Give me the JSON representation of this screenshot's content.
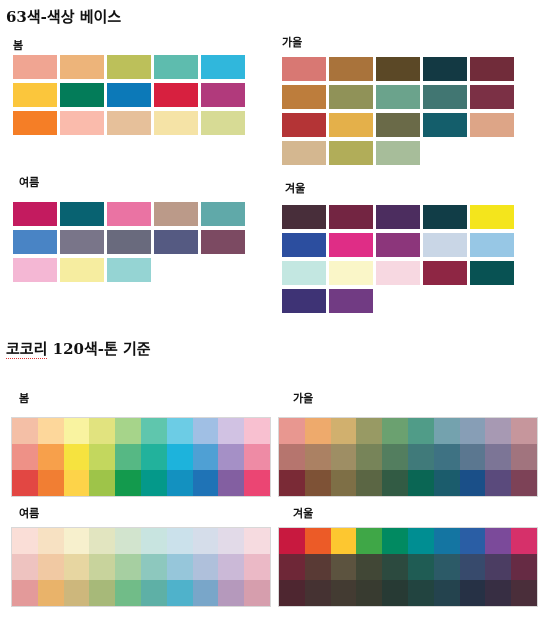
{
  "title_63": "63색-색상 베이스",
  "title_120": {
    "prefix": "코코리",
    "rest": " 120색-톤 기준"
  },
  "sec63": {
    "spring": {
      "label": "봄",
      "colors": [
        "#F0A592",
        "#EDB47A",
        "#BCC05A",
        "#5EBCAE",
        "#30B7DC",
        "#FBC63C",
        "#037C59",
        "#0C79B8",
        "#D7203F",
        "#B13A7C",
        "#F57E26",
        "#FABBAC",
        "#E6C09A",
        "#F5E3A6",
        "#D7DB95"
      ]
    },
    "autumn": {
      "label": "가을",
      "colors": [
        "#D87873",
        "#A9733B",
        "#5B4826",
        "#133943",
        "#712C3A",
        "#BD7D3C",
        "#909258",
        "#6BA38C",
        "#417672",
        "#7B3045",
        "#B43436",
        "#E4B04A",
        "#6A6A48",
        "#145E6B",
        "#DDA587",
        "#D4B790",
        "#B1AD59",
        "#A7BD9A"
      ]
    },
    "summer": {
      "label": "여름",
      "colors": [
        "#C31B5F",
        "#086271",
        "#EA73A3",
        "#BB9A89",
        "#60A9A9",
        "#4984C5",
        "#797589",
        "#696A7D",
        "#555A82",
        "#7C4A62",
        "#F4B7D4",
        "#F6EDA0",
        "#95D4D3"
      ]
    },
    "winter": {
      "label": "겨울",
      "colors": [
        "#482E3A",
        "#732542",
        "#4C2D5F",
        "#113D47",
        "#F4E51C",
        "#2C4E9F",
        "#DF2D86",
        "#8C367B",
        "#C9D6E6",
        "#97C7E5",
        "#C3E7E1",
        "#FAF6C8",
        "#F7D8E1",
        "#8E2644",
        "#085253",
        "#3E3375",
        "#713B83"
      ]
    }
  },
  "sec120": {
    "spring": {
      "label": "봄",
      "rows": [
        [
          "#F4BFA6",
          "#FDD79B",
          "#F9F3A0",
          "#E1E37F",
          "#A6D48A",
          "#5FC6AD",
          "#6CCCE5",
          "#A0BFE4",
          "#D1C2E3",
          "#F8C0D0"
        ],
        [
          "#EE9187",
          "#F7A04B",
          "#F6E33F",
          "#C3D75E",
          "#56B884",
          "#22B29C",
          "#1DB3DC",
          "#4FA0D4",
          "#A590C6",
          "#EE8BA5"
        ],
        [
          "#E24743",
          "#F17E33",
          "#FDD349",
          "#9EC449",
          "#139A4D",
          "#04998A",
          "#1391C0",
          "#1F73B6",
          "#835FA1",
          "#EB4573"
        ]
      ]
    },
    "autumn": {
      "label": "가을",
      "rows": [
        [
          "#E89790",
          "#EEAA6C",
          "#D1B06E",
          "#989A64",
          "#6BA170",
          "#509C88",
          "#74A2AE",
          "#879EB6",
          "#A799B3",
          "#C6969C"
        ],
        [
          "#B6756E",
          "#AB8163",
          "#9E8E64",
          "#778459",
          "#537E5F",
          "#407A7A",
          "#3E7283",
          "#5B7790",
          "#7C7596",
          "#A1747E"
        ],
        [
          "#7A2A36",
          "#7E5236",
          "#7E6F46",
          "#5B6644",
          "#325B44",
          "#0A6654",
          "#1B5C6C",
          "#1A4F88",
          "#5A4A7C",
          "#7D4257"
        ]
      ]
    },
    "summer": {
      "label": "여름",
      "rows": [
        [
          "#FADED7",
          "#F7E1C2",
          "#F7F0CD",
          "#E2E5C0",
          "#D2E4CE",
          "#C8E4E0",
          "#CBE1EB",
          "#D5DDEA",
          "#E2DAE8",
          "#F6DBE0"
        ],
        [
          "#EEC3C0",
          "#F1C9A3",
          "#E7D6A1",
          "#C8D39C",
          "#A6CFA1",
          "#8DC8BE",
          "#96C6DA",
          "#AFC0DB",
          "#CBB9D7",
          "#EBB9C6"
        ],
        [
          "#E39A9A",
          "#E9B36A",
          "#CDB77C",
          "#A7B979",
          "#71BC88",
          "#5EB0A6",
          "#4FB2CB",
          "#79A6C9",
          "#B599BC",
          "#D69EAD"
        ]
      ]
    },
    "winter": {
      "label": "겨울",
      "rows": [
        [
          "#C8193F",
          "#EC5B27",
          "#FDC730",
          "#3FA747",
          "#018A61",
          "#008E92",
          "#1475A2",
          "#2A5EA5",
          "#7B4A9A",
          "#D6306A"
        ],
        [
          "#6E2737",
          "#593A35",
          "#5C533F",
          "#414736",
          "#2C4A3F",
          "#1F5C54",
          "#2C5A67",
          "#374A6C",
          "#4B3D62",
          "#662B44"
        ],
        [
          "#4E2630",
          "#453232",
          "#433B32",
          "#383B30",
          "#273A34",
          "#224440",
          "#24434E",
          "#263145",
          "#372E43",
          "#4A2E3A"
        ]
      ]
    }
  }
}
